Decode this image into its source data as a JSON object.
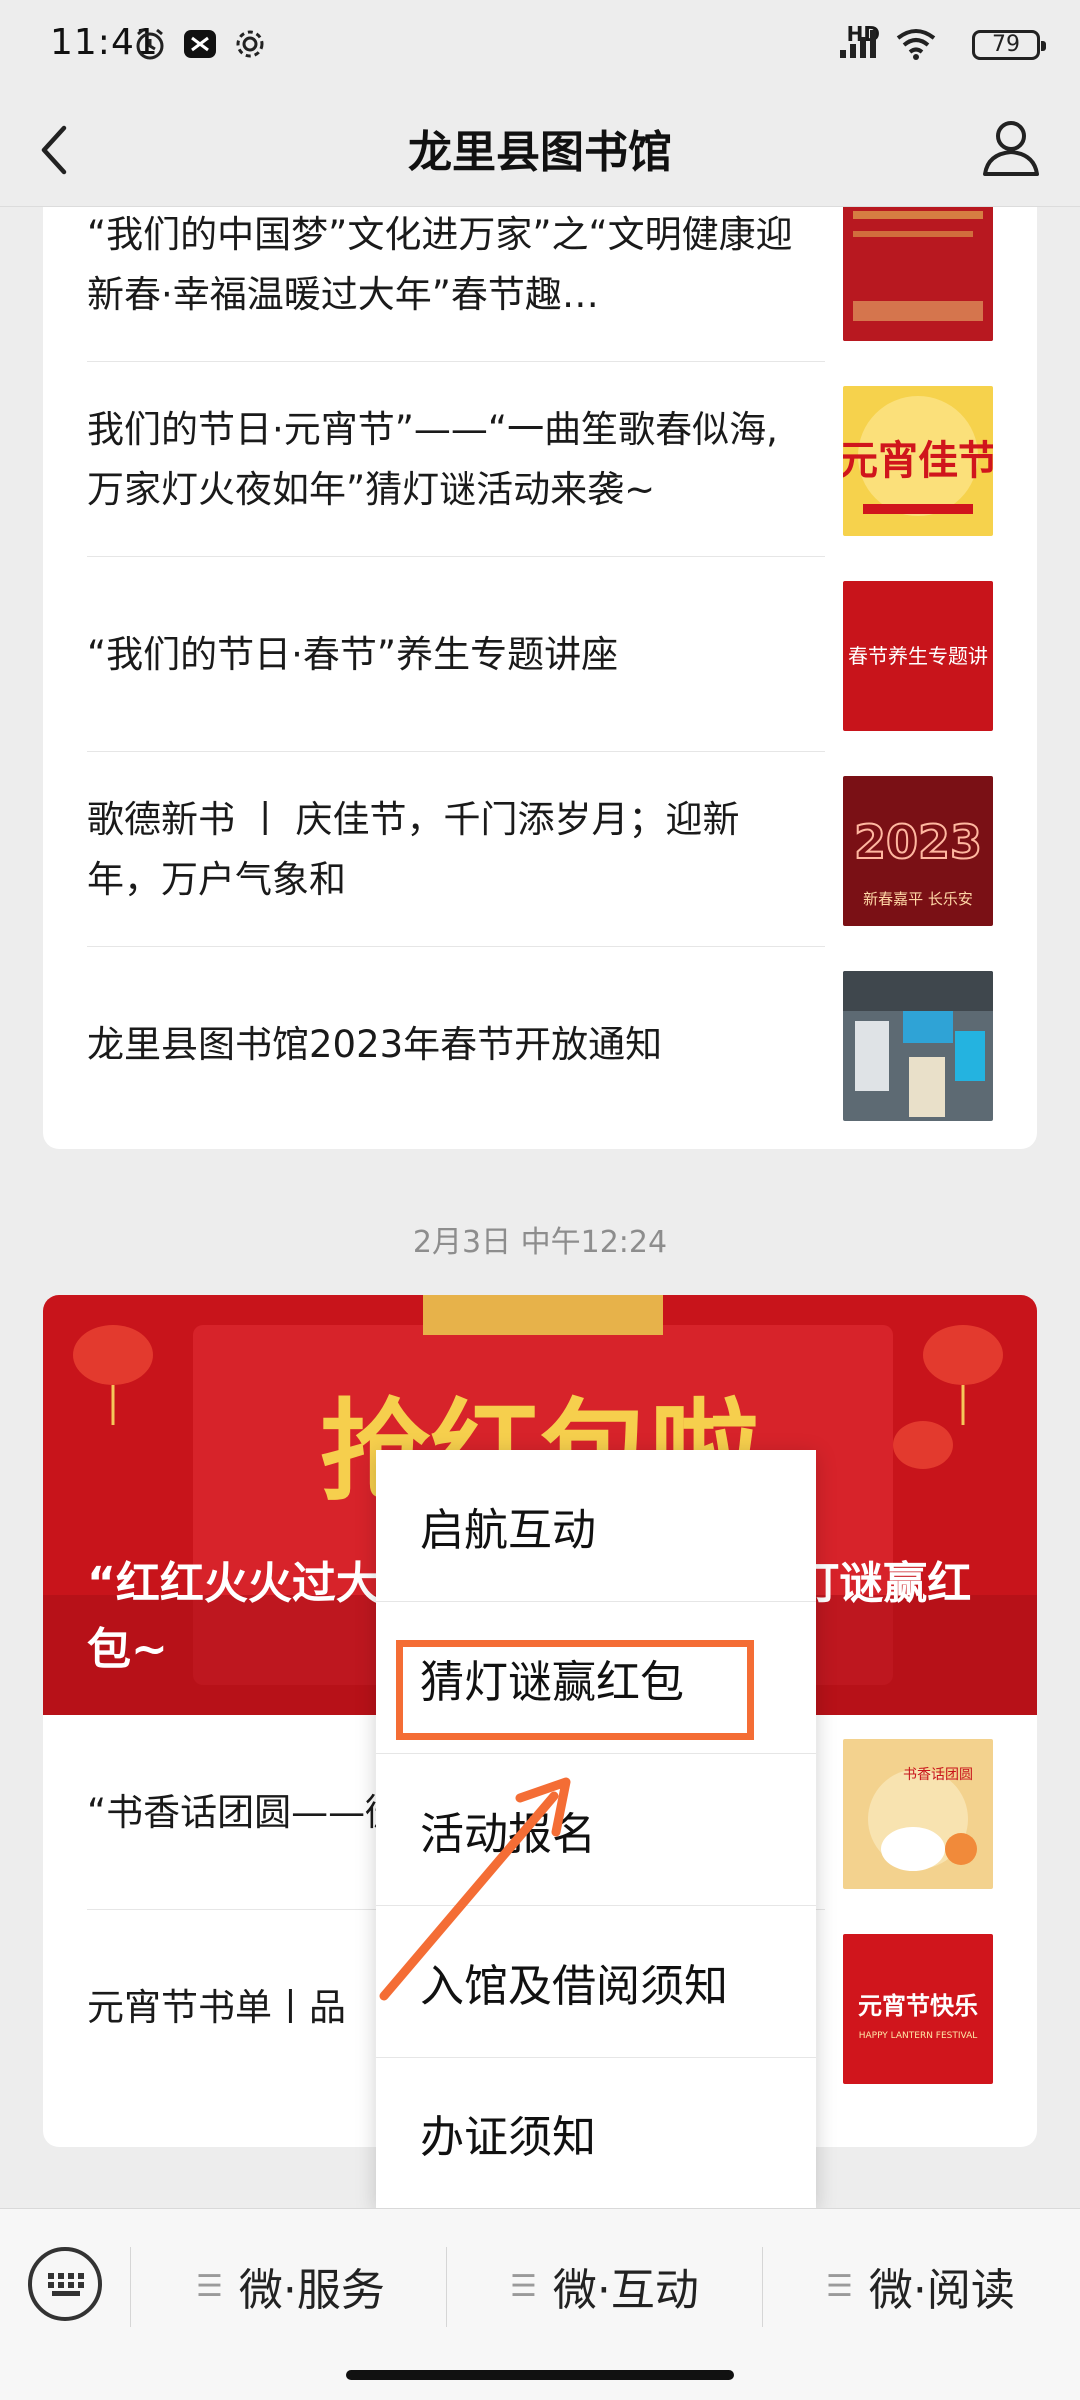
{
  "status": {
    "time": "11:41",
    "network": "HD",
    "battery": "79"
  },
  "header": {
    "title": "龙里县图书馆"
  },
  "articles": [
    {
      "title": "“我们的中国梦”文化进万家”之“文明健康迎新春·幸福温暖过大年”春节趣…"
    },
    {
      "title": "我们的节日·元宵节”——“一曲笙歌春似海,万家灯火夜如年”猜灯谜活动来袭~",
      "thumb_text": "元宵佳节"
    },
    {
      "title": "“我们的节日·春节”养生专题讲座",
      "thumb_text": "春节养生专题讲"
    },
    {
      "title": "歌德新书 丨 庆佳节，千门添岁月；迎新年，万户气象和",
      "thumb_text": "2023",
      "thumb_sub": "新春嘉平 长乐安"
    },
    {
      "title": "龙里县图书馆2023年春节开放通知"
    }
  ],
  "timestamp": "2月3日 中午12:24",
  "feature": {
    "banner_text": "抢红包啦",
    "title": "“红红火火过大年”2023年元宵节猜灯谜赢红包~"
  },
  "articles2": [
    {
      "title": "“书香话团圆——微信展",
      "thumb_text": "书香话团圆"
    },
    {
      "title": "元宵节书单丨品",
      "thumb_text": "元宵节快乐",
      "thumb_sub": "HAPPY LANTERN FESTIVAL"
    }
  ],
  "menu": [
    {
      "label": "启航互动"
    },
    {
      "label": "猜灯谜赢红包"
    },
    {
      "label": "活动报名"
    },
    {
      "label": "入馆及借阅须知"
    },
    {
      "label": "办证须知"
    }
  ],
  "bottom_tabs": [
    {
      "label": "微·服务"
    },
    {
      "label": "微·互动"
    },
    {
      "label": "微·阅读"
    }
  ],
  "colors": {
    "highlight": "#f46d35",
    "banner_red": "#c8141b"
  }
}
